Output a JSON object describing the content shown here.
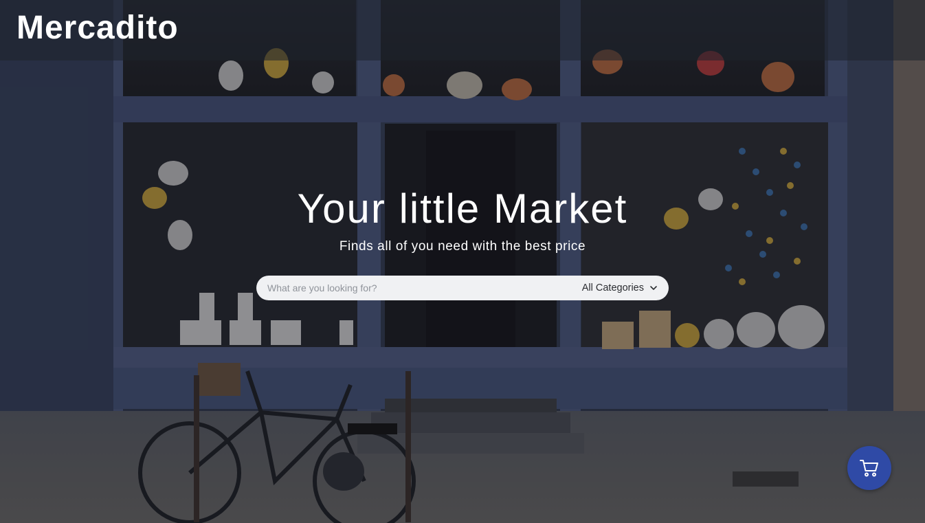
{
  "header": {
    "brand": "Mercadito"
  },
  "hero": {
    "title": "Your little Market",
    "subtitle": "Finds all of you need with the best price"
  },
  "search": {
    "placeholder": "What are you looking for?",
    "value": "",
    "category_selected": "All Categories",
    "category_icon": "chevron-down-icon"
  },
  "cart": {
    "icon": "shopping-cart-icon",
    "button_color": "#2f4aa6"
  },
  "colors": {
    "header_text": "#ffffff",
    "search_bg": "#f0f1f3",
    "accent": "#2f4aa6"
  }
}
